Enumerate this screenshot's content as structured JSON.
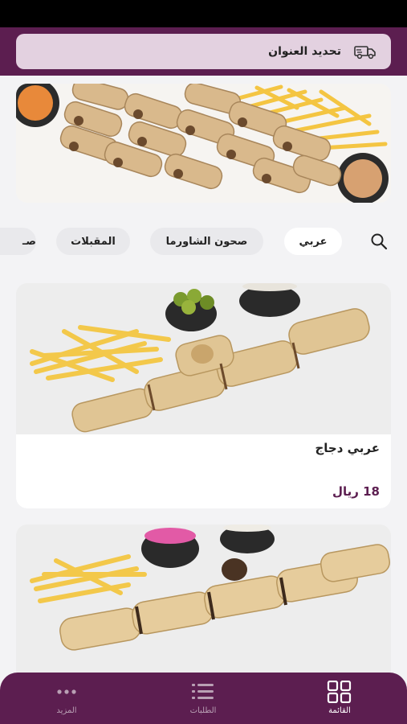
{
  "header": {
    "address_label": "تحديد العنوان"
  },
  "categories": {
    "items": [
      {
        "label": "عربي",
        "active": true
      },
      {
        "label": "صحون الشاورما",
        "active": false
      },
      {
        "label": "المقبلات",
        "active": false
      },
      {
        "label": "صـ",
        "active": false
      }
    ]
  },
  "menu": {
    "items": [
      {
        "name": "عربي دجاج",
        "price": "18 ريال"
      },
      {
        "name": "",
        "price": ""
      }
    ]
  },
  "bottom_nav": {
    "items": [
      {
        "label": "القائمة",
        "icon": "grid-icon",
        "active": true
      },
      {
        "label": "الطلبات",
        "icon": "list-icon",
        "active": false
      },
      {
        "label": "المزيد",
        "icon": "more-icon",
        "active": false
      }
    ]
  },
  "colors": {
    "brand": "#5c1e50",
    "address_bar": "#e3d1e0",
    "price": "#5c1e50"
  }
}
